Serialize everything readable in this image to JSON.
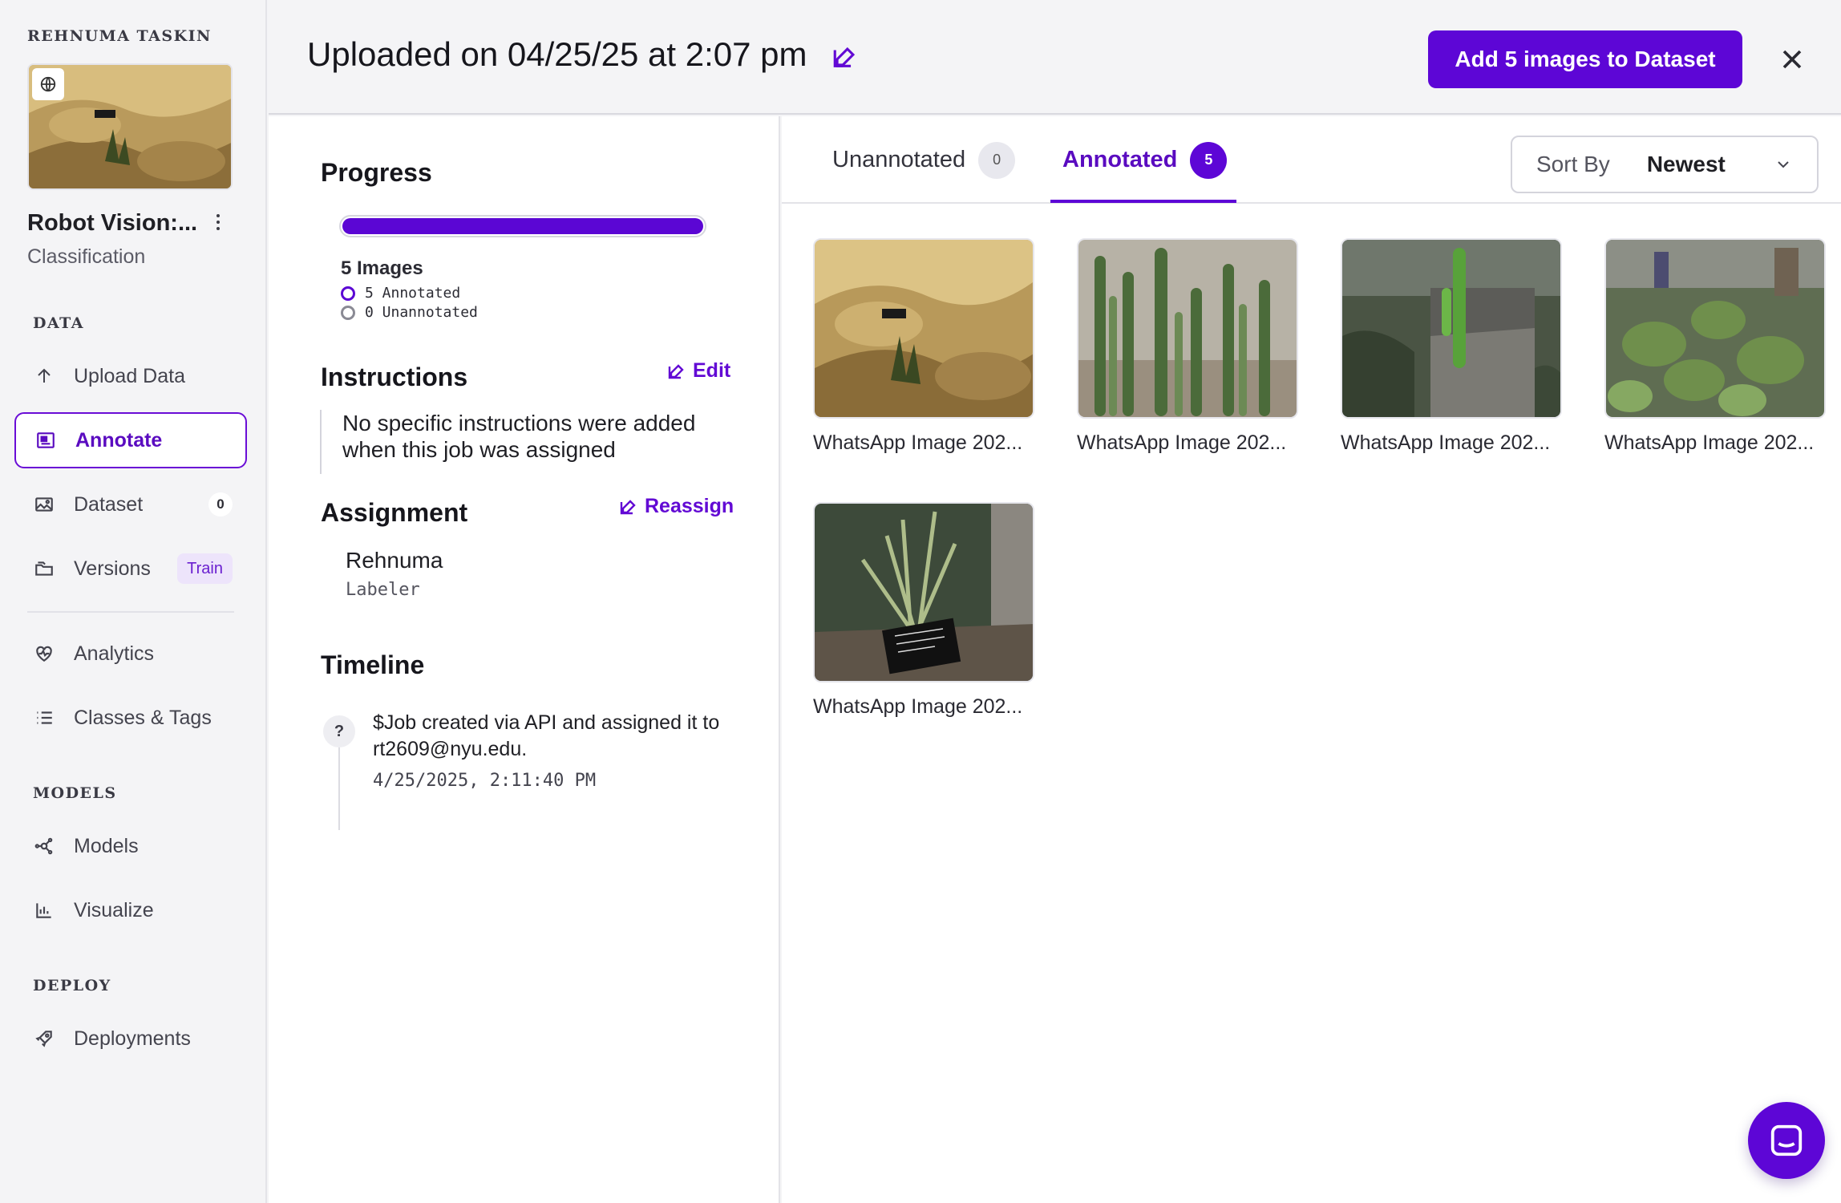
{
  "sidebar": {
    "workspace": "REHNUMA TASKIN",
    "project": {
      "title": "Robot Vision:...",
      "type": "Classification"
    },
    "sections": {
      "data": "DATA",
      "models": "MODELS",
      "deploy": "DEPLOY"
    },
    "items": {
      "upload": {
        "label": "Upload Data",
        "icon": "upload-arrow-icon"
      },
      "annotate": {
        "label": "Annotate",
        "icon": "annotate-icon",
        "active": true
      },
      "dataset": {
        "label": "Dataset",
        "icon": "image-icon",
        "badge": "0"
      },
      "versions": {
        "label": "Versions",
        "icon": "folders-icon",
        "pill": "Train"
      },
      "analytics": {
        "label": "Analytics",
        "icon": "heart-pulse-icon"
      },
      "classes": {
        "label": "Classes & Tags",
        "icon": "list-icon"
      },
      "models": {
        "label": "Models",
        "icon": "network-icon"
      },
      "visualize": {
        "label": "Visualize",
        "icon": "bar-chart-icon"
      },
      "deployments": {
        "label": "Deployments",
        "icon": "rocket-icon"
      }
    }
  },
  "header": {
    "title": "Uploaded on 04/25/25 at 2:07 pm",
    "primary_button": "Add 5 images to Dataset"
  },
  "info": {
    "progress": {
      "heading": "Progress",
      "fraction": 1.0,
      "images": "5 Images",
      "annotated": "5 Annotated",
      "unannotated": "0 Unannotated"
    },
    "instructions": {
      "heading": "Instructions",
      "edit": "Edit",
      "text": "No specific instructions were added when this job was assigned"
    },
    "assignment": {
      "heading": "Assignment",
      "reassign": "Reassign",
      "name": "Rehnuma",
      "role": "Labeler"
    },
    "timeline": {
      "heading": "Timeline",
      "dot": "?",
      "event": "$Job created via API and assigned it to rt2609@nyu.edu.",
      "time": "4/25/2025, 2:11:40 PM"
    }
  },
  "gallery": {
    "tabs": [
      {
        "label": "Unannotated",
        "count": "0"
      },
      {
        "label": "Annotated",
        "count": "5"
      }
    ],
    "sort": {
      "label": "Sort By",
      "value": "Newest"
    },
    "images": [
      {
        "name": "WhatsApp Image 202...",
        "scene": "sandy-rock"
      },
      {
        "name": "WhatsApp Image 202...",
        "scene": "cactus-columns"
      },
      {
        "name": "WhatsApp Image 202...",
        "scene": "cactus-stone-wall"
      },
      {
        "name": "WhatsApp Image 202...",
        "scene": "prickly-pear-greenhouse"
      },
      {
        "name": "WhatsApp Image 202...",
        "scene": "plant-with-sign"
      }
    ]
  },
  "colors": {
    "accent": "#5d06d6",
    "accent_text": "#5a0bc0"
  }
}
